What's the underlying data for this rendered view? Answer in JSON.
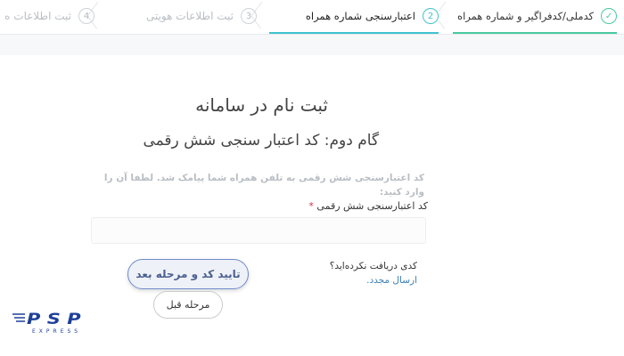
{
  "steps": [
    {
      "label": "کدملی/کدفراگیر و شماره همراه",
      "status": "done",
      "icon": "check-icon"
    },
    {
      "label": "اعتبارسنجی شماره همراه",
      "number": "2",
      "status": "active"
    },
    {
      "label": "ثبت اطلاعات هویتی",
      "number": "3",
      "status": "pending"
    },
    {
      "label": "ثبت اطلاعات ه",
      "number": "4",
      "status": "pending"
    }
  ],
  "form": {
    "title": "ثبت نام در سامانه",
    "subtitle": "گام دوم: کد اعتبار سنجی شش رقمی",
    "info": "کد اعتبارسنجی شش رقمی به تلفن همراه شما پیامک شد. لطفا آن را وارد کنید:",
    "code_label": "کد اعتبارسنجی شش رقمی",
    "required_mark": "*",
    "code_value": "",
    "resend_text": "کدی دریافت نکرده‌اید؟",
    "resend_link": "ارسال مجدد.",
    "confirm_button": "تایید کد و مرحله بعد",
    "back_button": "مرحله قبل"
  },
  "logo": {
    "text": "PSP",
    "subtext": "EXPRESS"
  },
  "colors": {
    "done": "#48c9a0",
    "active": "#3fc4cf",
    "pending": "#cfd3d8",
    "primary_border": "#6f8ccc",
    "link": "#3b7fb5",
    "logo": "#1e3f9a"
  }
}
